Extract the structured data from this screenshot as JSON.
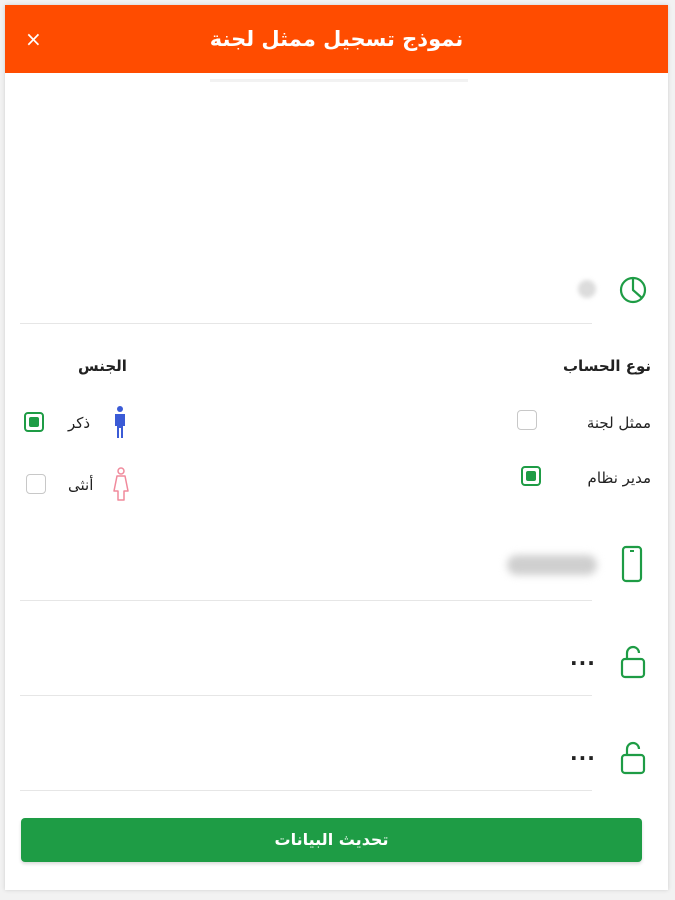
{
  "header": {
    "title": "نموذج تسجيل ممثل لجنة",
    "close_glyph": "×"
  },
  "account_type": {
    "title": "نوع الحساب",
    "options": [
      {
        "label": "ممثل لجنة",
        "checked": false
      },
      {
        "label": "مدير نظام",
        "checked": true
      }
    ]
  },
  "gender": {
    "title": "الجنس",
    "options": [
      {
        "label": "ذكر",
        "checked": true
      },
      {
        "label": "أنثى",
        "checked": false
      }
    ]
  },
  "password": {
    "masked": "···"
  },
  "confirm_password": {
    "masked": "···"
  },
  "submit_label": "تحديث البيانات",
  "colors": {
    "header": "#ff4c00",
    "accent_green": "#1e9c45",
    "male_icon": "#3b5bd6",
    "female_icon": "#f08a9c"
  }
}
